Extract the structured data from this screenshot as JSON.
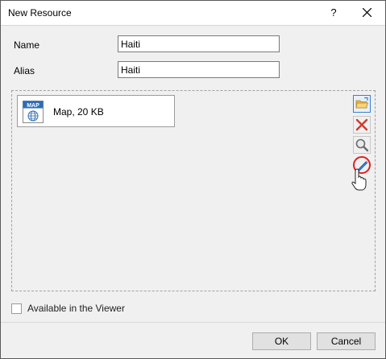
{
  "window": {
    "title": "New Resource",
    "help_label": "?",
    "close_icon": "close-icon"
  },
  "form": {
    "name_label": "Name",
    "name_value": "Haiti",
    "alias_label": "Alias",
    "alias_value": "Haiti"
  },
  "resource": {
    "icon_badge": "MAP",
    "label": "Map, 20 KB",
    "icon": "map-globe-icon"
  },
  "toolbar": {
    "open_icon": "folder-open-icon",
    "delete_icon": "delete-x-icon",
    "view_icon": "magnifier-icon",
    "edit_icon": "pencil-icon"
  },
  "options": {
    "available_in_viewer_label": "Available in the Viewer",
    "available_in_viewer_checked": false
  },
  "footer": {
    "ok_label": "OK",
    "cancel_label": "Cancel"
  },
  "colors": {
    "highlight_ring": "#e02020",
    "selected_tool_border": "#3a7fd0",
    "map_badge": "#2e6db4"
  }
}
